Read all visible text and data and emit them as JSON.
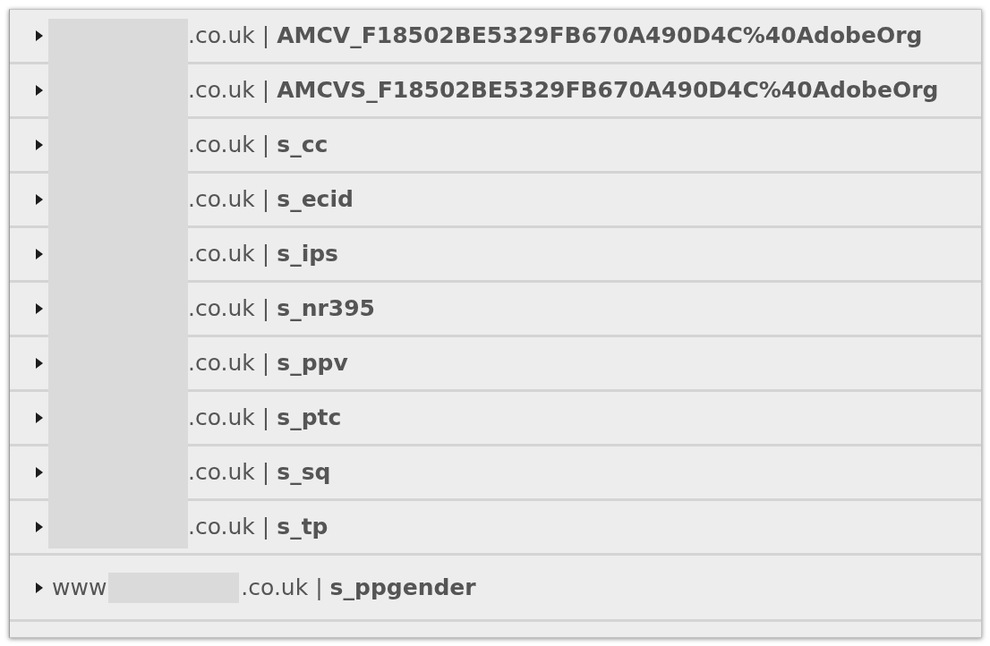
{
  "cookies": [
    {
      "expanded": false,
      "domain_redacted": true,
      "domain": ".co.uk",
      "separator": "|",
      "name": "AMCV_F18502BE5329FB670A490D4C%40AdobeOrg"
    },
    {
      "expanded": false,
      "domain_redacted": true,
      "domain": ".co.uk",
      "separator": "|",
      "name": "AMCVS_F18502BE5329FB670A490D4C%40AdobeOrg"
    },
    {
      "expanded": false,
      "domain_redacted": true,
      "domain": ".co.uk",
      "separator": "|",
      "name": "s_cc"
    },
    {
      "expanded": false,
      "domain_redacted": true,
      "domain": ".co.uk",
      "separator": "|",
      "name": "s_ecid"
    },
    {
      "expanded": false,
      "domain_redacted": true,
      "domain": ".co.uk",
      "separator": "|",
      "name": "s_ips"
    },
    {
      "expanded": false,
      "domain_redacted": true,
      "domain": ".co.uk",
      "separator": "|",
      "name": "s_nr395"
    },
    {
      "expanded": false,
      "domain_redacted": true,
      "domain": ".co.uk",
      "separator": "|",
      "name": "s_ppv"
    },
    {
      "expanded": false,
      "domain_redacted": true,
      "domain": ".co.uk",
      "separator": "|",
      "name": "s_ptc"
    },
    {
      "expanded": false,
      "domain_redacted": true,
      "domain": ".co.uk",
      "separator": "|",
      "name": "s_sq"
    },
    {
      "expanded": false,
      "domain_redacted": true,
      "domain": ".co.uk",
      "separator": "|",
      "name": "s_tp"
    },
    {
      "expanded": false,
      "domain_prefix": "www",
      "domain_redacted": true,
      "domain": ".co.uk",
      "separator": "|",
      "name": "s_ppgender"
    }
  ]
}
